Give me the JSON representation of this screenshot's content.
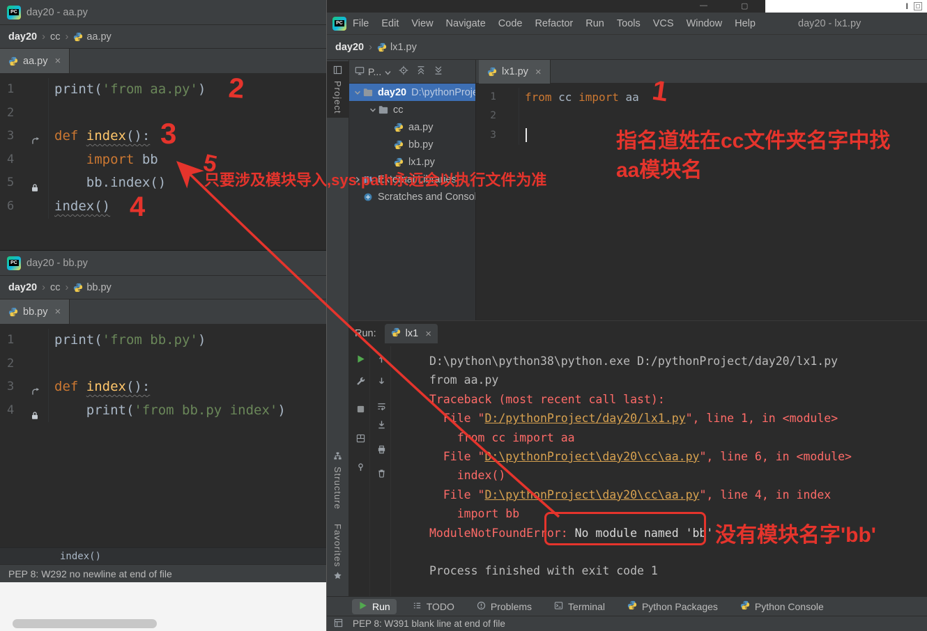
{
  "colors": {
    "annotation": "#e5342c",
    "selection": "#3d6fb4",
    "stderr": "#ff6b68",
    "link": "#d8a250",
    "keyword": "#cc7832",
    "string": "#6a8759"
  },
  "win_aa": {
    "title": "day20 - aa.py",
    "crumbs": [
      "day20",
      "cc",
      "aa.py"
    ],
    "tab": "aa.py",
    "close": "×",
    "code": [
      {
        "n": "1",
        "segs": [
          [
            "print",
            "p"
          ],
          [
            "(",
            "p"
          ],
          [
            "'from aa.py'",
            "s"
          ],
          [
            ")",
            "p"
          ]
        ]
      },
      {
        "n": "2",
        "segs": []
      },
      {
        "n": "3",
        "icon": "arrow",
        "segs": [
          [
            "def ",
            "k"
          ],
          [
            "index",
            "fn w"
          ],
          [
            "():",
            "p w"
          ]
        ]
      },
      {
        "n": "4",
        "segs": [
          [
            "    ",
            "p"
          ],
          [
            "import",
            "k"
          ],
          [
            " bb",
            "p"
          ]
        ]
      },
      {
        "n": "5",
        "icon": "lock",
        "segs": [
          [
            "    bb.index()",
            "p"
          ]
        ]
      },
      {
        "n": "6",
        "segs": [
          [
            "index()",
            "p w"
          ]
        ]
      }
    ]
  },
  "win_bb": {
    "title": "day20 - bb.py",
    "crumbs": [
      "day20",
      "cc",
      "bb.py"
    ],
    "tab": "bb.py",
    "close": "×",
    "code": [
      {
        "n": "1",
        "segs": [
          [
            "print",
            "p"
          ],
          [
            "(",
            "p"
          ],
          [
            "'from bb.py'",
            "s"
          ],
          [
            ")",
            "p"
          ]
        ]
      },
      {
        "n": "2",
        "segs": []
      },
      {
        "n": "3",
        "icon": "arrow",
        "segs": [
          [
            "def ",
            "k"
          ],
          [
            "index",
            "fn w"
          ],
          [
            "():",
            "p w"
          ]
        ]
      },
      {
        "n": "4",
        "icon": "lock",
        "segs": [
          [
            "    ",
            "p"
          ],
          [
            "print",
            "p"
          ],
          [
            "(",
            "p"
          ],
          [
            "'from bb.py index'",
            "s"
          ],
          [
            ")",
            "p"
          ]
        ]
      }
    ],
    "context": "index()",
    "status": "PEP 8: W292 no newline at end of file"
  },
  "main": {
    "menu": [
      "File",
      "Edit",
      "View",
      "Navigate",
      "Code",
      "Refactor",
      "Run",
      "Tools",
      "VCS",
      "Window",
      "Help"
    ],
    "window_title": "day20 - lx1.py",
    "crumbs": [
      "day20",
      "lx1.py"
    ],
    "project_panel": {
      "dropdown": "P...",
      "tree": [
        {
          "label": "day20",
          "suffix": " D:\\pythonProject",
          "icon": "folder",
          "chev": "open",
          "indent": 0,
          "selected": true
        },
        {
          "label": "cc",
          "icon": "folder",
          "chev": "open",
          "indent": 1
        },
        {
          "label": "aa.py",
          "icon": "py",
          "indent": 2
        },
        {
          "label": "bb.py",
          "icon": "py",
          "indent": 2
        },
        {
          "label": "lx1.py",
          "icon": "py",
          "indent": 2
        },
        {
          "label": "External Libraries",
          "icon": "lib",
          "chev": "closed",
          "indent": 0
        },
        {
          "label": "Scratches and Consoles",
          "icon": "scratch",
          "indent": 0
        }
      ]
    },
    "tab": "lx1.py",
    "tab_close": "×",
    "editor_code": [
      {
        "n": "1",
        "segs": [
          [
            "from",
            "k"
          ],
          [
            " cc ",
            "p"
          ],
          [
            "import",
            "k"
          ],
          [
            " aa",
            "p"
          ]
        ]
      },
      {
        "n": "2",
        "segs": []
      },
      {
        "n": "3",
        "caret": true,
        "segs": []
      }
    ],
    "sidebar": {
      "top": "Project",
      "mid": "Structure",
      "bottom": "Favorites"
    },
    "run_panel": {
      "label": "Run:",
      "tab": "lx1",
      "tab_close": "×",
      "console": [
        {
          "segs": [
            [
              "D:\\python\\python38\\python.exe D:/pythonProject/day20/lx1.py",
              "out"
            ]
          ]
        },
        {
          "segs": [
            [
              "from aa.py",
              "out"
            ]
          ]
        },
        {
          "segs": [
            [
              "Traceback (most recent call last):",
              "err"
            ]
          ]
        },
        {
          "segs": [
            [
              "  File \"",
              "err"
            ],
            [
              "D:/pythonProject/day20/lx1.py",
              "link"
            ],
            [
              "\", line 1, in <module>",
              "err"
            ]
          ]
        },
        {
          "segs": [
            [
              "    from cc import aa",
              "err"
            ]
          ]
        },
        {
          "segs": [
            [
              "  File \"",
              "err"
            ],
            [
              "D:\\pythonProject\\day20\\cc\\aa.py",
              "link"
            ],
            [
              "\", line 6, in <module>",
              "err"
            ]
          ]
        },
        {
          "segs": [
            [
              "    index()",
              "err"
            ]
          ]
        },
        {
          "segs": [
            [
              "  File \"",
              "err"
            ],
            [
              "D:\\pythonProject\\day20\\cc\\aa.py",
              "link"
            ],
            [
              "\", line 4, in index",
              "err"
            ]
          ]
        },
        {
          "segs": [
            [
              "    import bb",
              "err"
            ]
          ]
        },
        {
          "segs": [
            [
              "ModuleNotFoundError: ",
              "err"
            ],
            [
              "No module named 'bb'",
              "hl"
            ]
          ]
        },
        {
          "segs": []
        },
        {
          "segs": [
            [
              "Process finished with exit code 1",
              "out"
            ]
          ]
        }
      ]
    },
    "bottom_bar": [
      {
        "label": "Run",
        "icon": "play",
        "active": true
      },
      {
        "label": "TODO",
        "icon": "todo"
      },
      {
        "label": "Problems",
        "icon": "problems"
      },
      {
        "label": "Terminal",
        "icon": "terminal"
      },
      {
        "label": "Python Packages",
        "icon": "py"
      },
      {
        "label": "Python Console",
        "icon": "py"
      }
    ],
    "status": "PEP 8: W391 blank line at end of file"
  },
  "annotations": {
    "mark_1": "1",
    "mark_2": "2",
    "mark_3": "3",
    "mark_4": "4",
    "mark_5": "5",
    "note_right_line1": "指名道姓在cc文件夹名字中找",
    "note_right_line2": "aa模块名",
    "note_syspath": "只要涉及模块导入,sys.path永远会以执行文件为准",
    "note_error": "没有模块名字'bb'"
  }
}
